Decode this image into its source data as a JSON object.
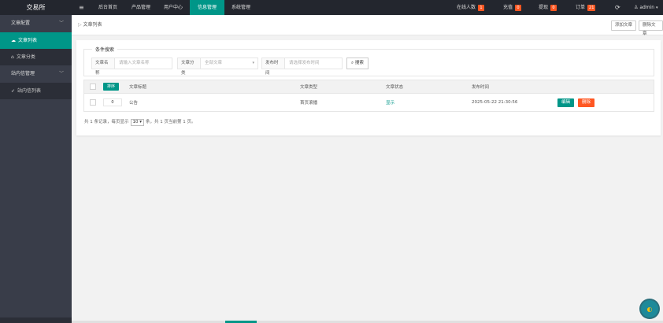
{
  "app": {
    "logo": "交易所",
    "menu_icon": "menu-icon"
  },
  "topnav": {
    "tabs": [
      {
        "label": "后台首页"
      },
      {
        "label": "产品管理"
      },
      {
        "label": "用户中心"
      },
      {
        "label": "信息管理",
        "active": true
      },
      {
        "label": "系统管理"
      }
    ],
    "right": {
      "online": {
        "label": "在线人数",
        "count": "1"
      },
      "recharge": {
        "label": "充值",
        "count": "0"
      },
      "withdraw": {
        "label": "提现",
        "count": "0"
      },
      "orders": {
        "label": "订单",
        "count": "21"
      },
      "refresh_icon": "refresh-icon",
      "user": "admin"
    }
  },
  "sidebar": {
    "groups": [
      {
        "label": "文章配置",
        "items": [
          {
            "label": "文章列表",
            "icon": "cloud-icon",
            "active": true
          },
          {
            "label": "文章分类",
            "icon": "tag-icon"
          }
        ]
      },
      {
        "label": "站内信管理",
        "items": [
          {
            "label": "站内信列表",
            "icon": "send-icon"
          }
        ]
      }
    ]
  },
  "tabbar": {
    "breadcrumb": "文章列表",
    "add_button": "添加文章",
    "delete_button": "删除文章"
  },
  "filters": {
    "legend": "条件搜索",
    "name_label": "文章名称",
    "name_placeholder": "请输入文章名称",
    "category_label": "文章分类",
    "category_value": "全部文章",
    "date_label": "发布时间",
    "date_placeholder": "请选择发布时间",
    "search_button": "搜索"
  },
  "table": {
    "headers": {
      "sort_button": "排序",
      "title": "文章标题",
      "category": "文章类型",
      "status": "文章状态",
      "date": "发布时间"
    },
    "rows": [
      {
        "sort": "0",
        "title": "公告",
        "category": "首页滚播",
        "status": "显示",
        "date": "2025-05-22 21:30:56",
        "edit": "编辑",
        "delete": "删除"
      }
    ]
  },
  "pager": {
    "prefix": "共 1 条记录，每页显示",
    "page_size": "10",
    "suffix": "条，共 1 页当前第 1 页。"
  },
  "colors": {
    "accent": "#009688",
    "danger": "#ff5722",
    "sidebar": "#393d49",
    "topbar": "#23262e"
  }
}
